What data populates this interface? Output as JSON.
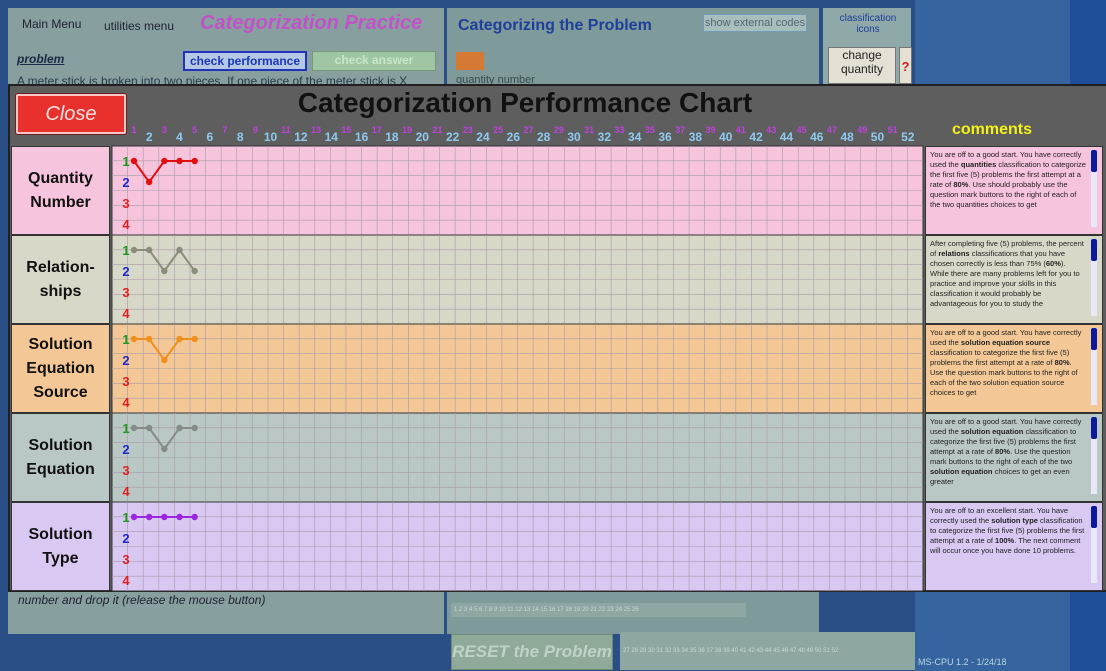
{
  "app": {
    "main_menu": "Main Menu",
    "utilities_menu": "utilities menu",
    "title": "Categorization Practice",
    "categorizing_title": "Categorizing the Problem",
    "show_external_codes": "show external codes",
    "classification_icons": "classification icons",
    "problem_label": "problem",
    "check_performance": "check performance",
    "check_answer": "check answer",
    "problem_text": "A meter stick is broken into two pieces. If one piece of the meter stick is X",
    "quantity_number_label": "quantity number",
    "change_btn": "change quantity",
    "question_mark": "?",
    "drop_text": "number and drop it (release the mouse button)",
    "reset_button": "RESET the Problem",
    "strip_left": "1 2 3 4 5 6 7 8 9 10 11 12 13 14 15 16 17 18 19 20 21 22 23 24 25 26",
    "strip_right": "27 28 29 30 31 32 33 34 35 36 37 38 39 40 41 42 43 44 45 46 47 48 49 50 51 52",
    "version": "MS-CPU 1.2 - 1/24/18"
  },
  "chart": {
    "close_label": "Close",
    "title": "Categorization Performance Chart",
    "comments_header": "comments",
    "level_labels": [
      "1",
      "2",
      "3",
      "4"
    ],
    "level_colors": [
      "#1a9a1a",
      "#1a2acc",
      "#e02020",
      "#e02020"
    ],
    "problem_numbers_count": 52
  },
  "chart_data": {
    "type": "line",
    "x": [
      1,
      2,
      3,
      4,
      5
    ],
    "ylim": [
      1,
      4
    ],
    "series": [
      {
        "name": "Quantity Number",
        "values": [
          1,
          2,
          1,
          1,
          1
        ],
        "color": "#e01010",
        "bg": "#f6c4dc"
      },
      {
        "name": "Relation-ships",
        "values": [
          1,
          1,
          2,
          1,
          2
        ],
        "color": "#8c8c7a",
        "bg": "#d8d8c8"
      },
      {
        "name": "Solution Equation Source",
        "values": [
          1,
          1,
          2,
          1,
          1
        ],
        "color": "#f0901c",
        "bg": "#f4c896"
      },
      {
        "name": "Solution Equation",
        "values": [
          1,
          1,
          2,
          1,
          1
        ],
        "color": "#848c88",
        "bg": "#b9c8c4"
      },
      {
        "name": "Solution Type",
        "values": [
          1,
          1,
          1,
          1,
          1
        ],
        "color": "#9a28e0",
        "bg": "#d8c8f2"
      }
    ]
  },
  "rows": [
    {
      "label_lines": [
        "Quantity",
        "Number"
      ],
      "comment_html": "You are off to a good start. You have correctly used the <b>quantities</b> classification to categorize the first five (5) problems the first attempt at a rate of <b>80%</b>. Use should probably use the question mark buttons to the right of each of the two quantities choices to get"
    },
    {
      "label_lines": [
        "Relation-",
        "ships"
      ],
      "comment_html": "After completing five (5) problems, the percent of <b>relations</b> classifications that you have chosen correctly is less than 75% (<b>60%</b>). While there are many problems left for you to practice and improve your skills in this classification it would probably be advantageous for you to study the"
    },
    {
      "label_lines": [
        "Solution",
        "Equation",
        "Source"
      ],
      "comment_html": "You are off to a good start. You have correctly used the <b>solution equation source</b> classification to categorize the first five (5) problems the first attempt at a rate of <b>80%</b>. Use the question mark buttons to the right of each of the two solution equation source choices to get"
    },
    {
      "label_lines": [
        "Solution",
        "Equation"
      ],
      "comment_html": "You are off to a good start. You have correctly used the <b>solution equation</b> classification to categorize the first five (5) problems the first attempt at a rate of <b>80%</b>. Use the question mark buttons to the right of each of the two <b>solution equation</b> choices to get an even greater"
    },
    {
      "label_lines": [
        "Solution",
        "Type"
      ],
      "comment_html": "You are off to an excellent start. You have correctly used the <b>solution type</b> classification to categorize the first five (5) problems the first attempt at a rate of <b>100%</b>. The next comment will occur once you have done 10 problems."
    }
  ]
}
